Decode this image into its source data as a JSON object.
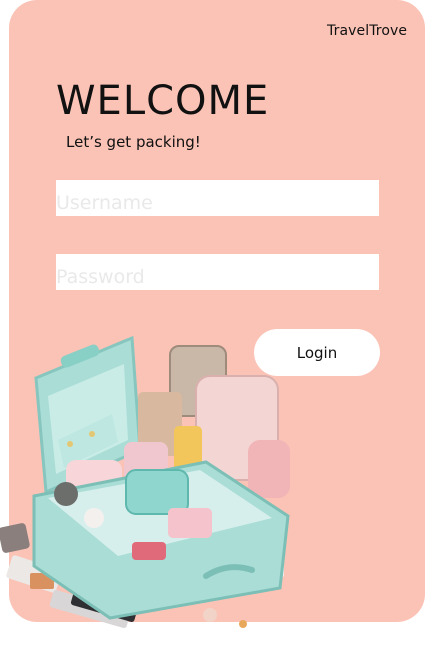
{
  "brand": "TravelTrove",
  "heading": "WELCOME",
  "tagline": "Let’s get packing!",
  "form": {
    "username_placeholder": "Username",
    "password_placeholder": "Password",
    "login_label": "Login"
  },
  "colors": {
    "background": "#fbc3b6",
    "field": "#ffffff",
    "button": "#ffffff",
    "suitcase": "#a9ddd6"
  },
  "illustration": "open-suitcase-illustration"
}
